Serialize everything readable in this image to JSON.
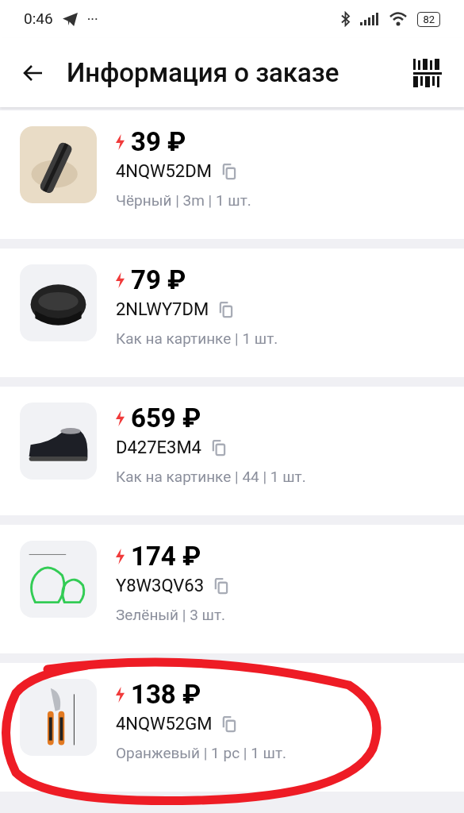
{
  "status_bar": {
    "time": "0:46",
    "more": "···",
    "battery": "82"
  },
  "header": {
    "title": "Информация о заказе"
  },
  "items": [
    {
      "price": "39 ₽",
      "code": "4NQW52DM",
      "details": "Чёрный | 3m | 1 шт.",
      "circled": false
    },
    {
      "price": "79 ₽",
      "code": "2NLWY7DM",
      "details": "Как на картинке | 1 шт.",
      "circled": false
    },
    {
      "price": "659 ₽",
      "code": "D427E3M4",
      "details": "Как на картинке | 44 | 1 шт.",
      "circled": false
    },
    {
      "price": "174 ₽",
      "code": "Y8W3QV63",
      "details": "Зелёный | 3 шт.",
      "circled": false
    },
    {
      "price": "138 ₽",
      "code": "4NQW52GM",
      "details": "Оранжевый | 1 pc | 1 шт.",
      "circled": true
    }
  ]
}
